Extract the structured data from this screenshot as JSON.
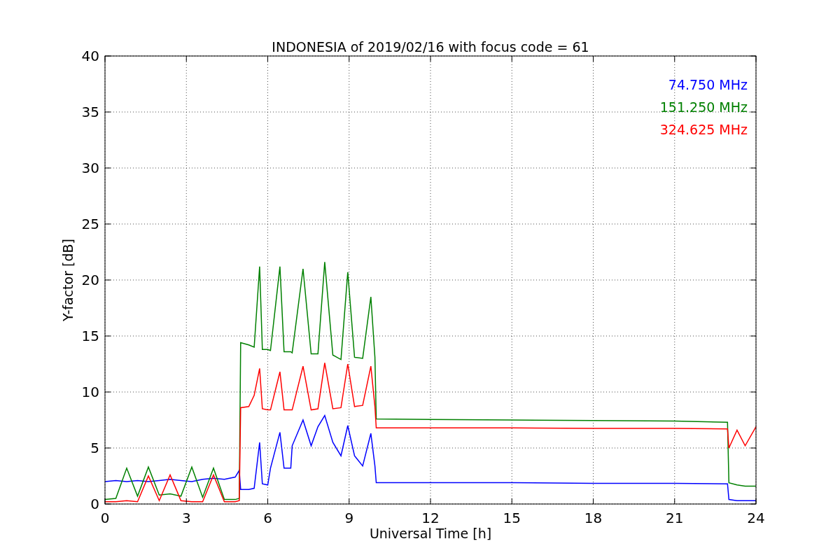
{
  "chart_data": {
    "type": "line",
    "title": "INDONESIA of 2019/02/16 with focus code = 61",
    "xlabel": "Universal Time [h]",
    "ylabel": "Y-factor [dB]",
    "x": [
      0,
      0.4,
      0.8,
      1.2,
      1.6,
      2.0,
      2.4,
      2.8,
      3.2,
      3.6,
      4.0,
      4.4,
      4.8,
      4.95,
      5.0,
      5.3,
      5.5,
      5.7,
      5.8,
      6.0,
      6.1,
      6.45,
      6.6,
      6.85,
      6.9,
      7.3,
      7.6,
      7.85,
      8.1,
      8.4,
      8.7,
      8.95,
      9.2,
      9.5,
      9.8,
      9.95,
      10.0,
      12,
      15,
      18,
      21,
      22.95,
      23.0,
      23.3,
      23.6,
      24
    ],
    "grid": true,
    "xlim": [
      0,
      24
    ],
    "ylim": [
      0,
      40
    ],
    "xticks": [
      0,
      3,
      6,
      9,
      12,
      15,
      18,
      21,
      24
    ],
    "yticks": [
      0,
      5,
      10,
      15,
      20,
      25,
      30,
      35,
      40
    ],
    "series": [
      {
        "name": "74.750 MHz",
        "color": "#0000ff",
        "values": [
          2.0,
          2.1,
          2.0,
          2.1,
          2.0,
          2.1,
          2.2,
          2.1,
          2.0,
          2.2,
          2.3,
          2.2,
          2.4,
          3.0,
          1.3,
          1.3,
          1.4,
          5.5,
          1.8,
          1.7,
          3.2,
          6.4,
          3.2,
          3.2,
          5.2,
          7.5,
          5.2,
          6.9,
          7.9,
          5.5,
          4.3,
          7.0,
          4.3,
          3.4,
          6.3,
          3.4,
          1.9,
          1.9,
          1.9,
          1.85,
          1.85,
          1.8,
          0.4,
          0.3,
          0.3,
          0.3
        ]
      },
      {
        "name": "151.250 MHz",
        "color": "#008000",
        "values": [
          0.4,
          0.5,
          3.2,
          0.7,
          3.3,
          0.8,
          0.9,
          0.7,
          3.3,
          0.6,
          3.2,
          0.4,
          0.4,
          0.5,
          14.4,
          14.2,
          14.0,
          21.2,
          13.8,
          13.8,
          13.7,
          21.2,
          13.6,
          13.6,
          13.5,
          21.0,
          13.4,
          13.4,
          21.6,
          13.3,
          12.9,
          20.7,
          13.1,
          13.0,
          18.5,
          13.1,
          7.6,
          7.55,
          7.5,
          7.45,
          7.4,
          7.3,
          1.9,
          1.7,
          1.6,
          1.6
        ]
      },
      {
        "name": "324.625 MHz",
        "color": "#ff0000",
        "values": [
          0.2,
          0.2,
          0.3,
          0.2,
          2.5,
          0.3,
          2.6,
          0.3,
          0.2,
          0.2,
          2.6,
          0.2,
          0.2,
          0.3,
          8.6,
          8.7,
          9.7,
          12.1,
          8.5,
          8.4,
          8.4,
          11.8,
          8.4,
          8.4,
          8.4,
          12.3,
          8.4,
          8.5,
          12.6,
          8.5,
          8.6,
          12.5,
          8.7,
          8.8,
          12.3,
          8.7,
          6.8,
          6.8,
          6.8,
          6.75,
          6.75,
          6.7,
          5.0,
          6.6,
          5.2,
          6.9
        ]
      }
    ]
  }
}
